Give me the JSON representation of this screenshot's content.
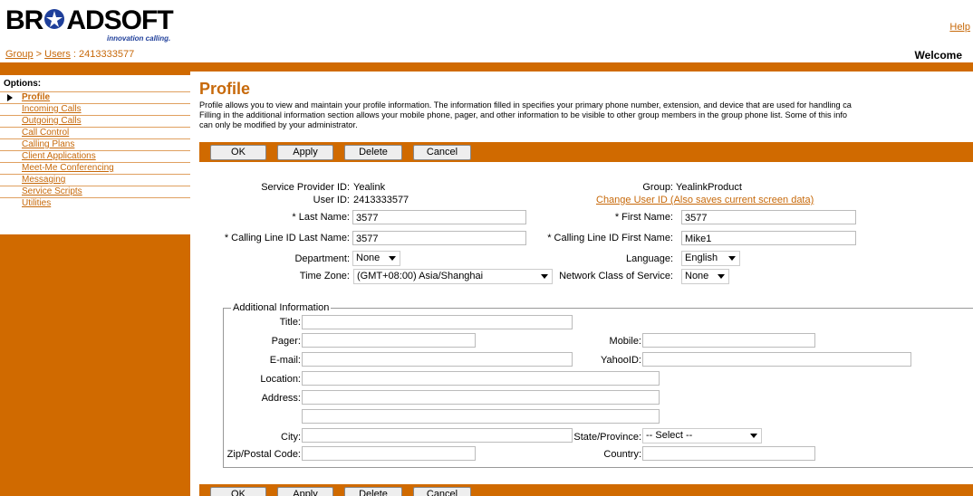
{
  "header": {
    "logo_text": "BROADSOFT",
    "tagline": "innovation calling.",
    "help": "Help",
    "breadcrumb": {
      "group": "Group",
      "sep": " > ",
      "users": "Users",
      "suffix": " : 2413333577"
    },
    "welcome": "Welcome"
  },
  "sidebar": {
    "heading": "Options:",
    "items": [
      {
        "label": "Profile",
        "active": true
      },
      {
        "label": "Incoming Calls"
      },
      {
        "label": "Outgoing Calls"
      },
      {
        "label": "Call Control"
      },
      {
        "label": "Calling Plans"
      },
      {
        "label": "Client Applications"
      },
      {
        "label": "Meet-Me Conferencing"
      },
      {
        "label": "Messaging"
      },
      {
        "label": "Service Scripts"
      },
      {
        "label": "Utilities"
      }
    ]
  },
  "main": {
    "title": "Profile",
    "description": [
      "Profile allows you to view and maintain your profile information. The information filled in specifies your primary phone number, extension, and device that are used for handling ca",
      "Filling in the additional information section allows your mobile phone, pager, and other information to be visible to other group members in the group phone list. Some of this info",
      "can only be modified by your administrator."
    ],
    "buttons": {
      "ok": "OK",
      "apply": "Apply",
      "delete": "Delete",
      "cancel": "Cancel"
    },
    "profile": {
      "service_provider_label": "Service Provider ID:",
      "service_provider_value": "Yealink",
      "group_label": "Group:",
      "group_value": "YealinkProduct",
      "user_id_label": "User ID:",
      "user_id_value": "2413333577",
      "change_user_id": "Change User ID (Also saves current screen data)",
      "last_name_label": "* Last Name:",
      "last_name_value": "3577",
      "first_name_label": "* First Name:",
      "first_name_value": "3577",
      "cli_last_label": "* Calling Line ID Last Name:",
      "cli_last_value": "3577",
      "cli_first_label": "* Calling Line ID First Name:",
      "cli_first_value": "Mike1",
      "department_label": "Department:",
      "department_value": "None",
      "language_label": "Language:",
      "language_value": "English",
      "timezone_label": "Time Zone:",
      "timezone_value": "(GMT+08:00) Asia/Shanghai",
      "ncos_label": "Network Class of Service:",
      "ncos_value": "None"
    },
    "additional": {
      "legend": "Additional Information",
      "title_label": "Title:",
      "title_value": "",
      "pager_label": "Pager:",
      "pager_value": "",
      "mobile_label": "Mobile:",
      "mobile_value": "",
      "email_label": "E-mail:",
      "email_value": "",
      "yahoo_label": "YahooID:",
      "yahoo_value": "",
      "location_label": "Location:",
      "location_value": "",
      "address_label": "Address:",
      "address_value": "",
      "address2_value": "",
      "city_label": "City:",
      "city_value": "",
      "state_label": "State/Province:",
      "state_value": "-- Select --",
      "zip_label": "Zip/Postal Code:",
      "zip_value": "",
      "country_label": "Country:",
      "country_value": ""
    }
  },
  "colors": {
    "accent": "#d06a00",
    "link": "#c7690a",
    "brand_blue": "#1f3f9a"
  }
}
